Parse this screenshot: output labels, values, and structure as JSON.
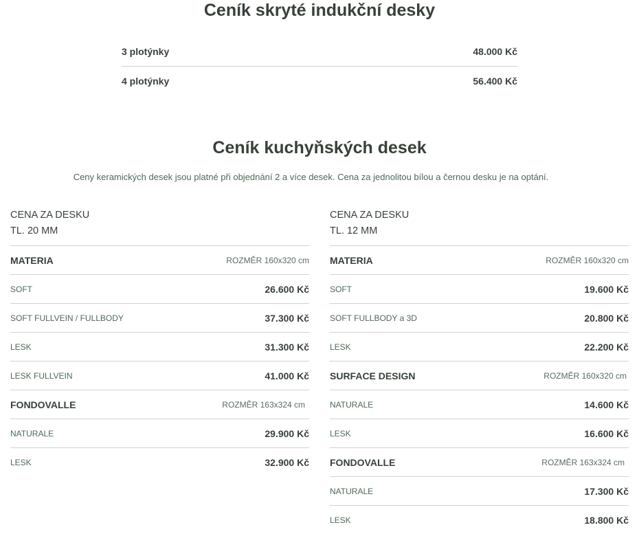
{
  "hob": {
    "title": "Ceník skryté indukční desky",
    "rows": [
      {
        "label": "3 plotýnky",
        "price": "48.000 Kč"
      },
      {
        "label": "4 plotýnky",
        "price": "56.400 Kč"
      }
    ]
  },
  "countertops": {
    "title": "Ceník kuchyňských desek",
    "note": "Ceny keramických desek jsou platné při objednání 2 a více desek. Cena za jednolitou bílou a černou desku je na optání.",
    "left": {
      "head_line1": "CENA ZA DESKU",
      "head_line2": "TL. 20 MM",
      "materia": {
        "name": "MATERIA",
        "size": "ROZMĚR 160x320 cm"
      },
      "materia_items": [
        {
          "name": "SOFT",
          "price": "26.600 Kč"
        },
        {
          "name": "SOFT FULLVEIN / FULLBODY",
          "price": "37.300 Kč"
        },
        {
          "name": "LESK",
          "price": "31.300 Kč"
        },
        {
          "name": "LESK FULLVEIN",
          "price": "41.000 Kč"
        }
      ],
      "fondovalle": {
        "name": "FONDOVALLE",
        "size": "ROZMĚR 163x324 cm"
      },
      "fondovalle_items": [
        {
          "name": "NATURALE",
          "price": "29.900 Kč"
        },
        {
          "name": "LESK",
          "price": "32.900 Kč"
        }
      ]
    },
    "right": {
      "head_line1": "CENA ZA DESKU",
      "head_line2": "TL. 12 MM",
      "materia": {
        "name": "MATERIA",
        "size": "ROZMĚR 160x320 cm"
      },
      "materia_items": [
        {
          "name": "SOFT",
          "price": "19.600 Kč"
        },
        {
          "name": "SOFT FULLBODY a 3D",
          "price": "20.800 Kč"
        },
        {
          "name": "LESK",
          "price": "22.200 Kč"
        }
      ],
      "surface": {
        "name": "SURFACE DESIGN",
        "size": "ROZMĚR 160x320 cm"
      },
      "surface_items": [
        {
          "name": "NATURALE",
          "price": "14.600 Kč"
        },
        {
          "name": "LESK",
          "price": "16.600 Kč"
        }
      ],
      "fondovalle": {
        "name": "FONDOVALLE",
        "size": "ROZMĚR 163x324 cm"
      },
      "fondovalle_items": [
        {
          "name": "NATURALE",
          "price": "17.300 Kč"
        },
        {
          "name": "LESK",
          "price": "18.800 Kč"
        }
      ]
    }
  }
}
